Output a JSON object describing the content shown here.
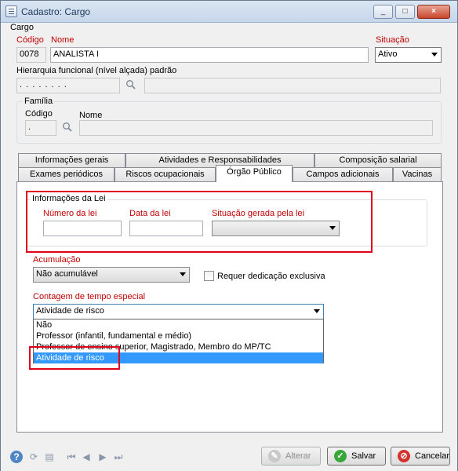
{
  "window": {
    "title": "Cadastro: Cargo",
    "controls": [
      "_",
      "□",
      "×"
    ]
  },
  "cargo_group": {
    "title": "Cargo",
    "codigo_label": "Código",
    "codigo_value": "0078",
    "nome_label": "Nome",
    "nome_value": "ANALISTA I",
    "situacao_label": "Situação",
    "situacao_value": "Ativo",
    "hierarquia_label": "Hierarquia funcional (nível alçada) padrão",
    "hierarquia_value": ". . . . . . . ."
  },
  "familia_group": {
    "title": "Família",
    "codigo_label": "Código",
    "codigo_value": ".",
    "nome_label": "Nome",
    "nome_value": ""
  },
  "tabs": {
    "row1": [
      "Informações gerais",
      "Atividades e Responsabilidades",
      "Composição salarial"
    ],
    "row2": [
      "Exames periódicos",
      "Riscos ocupacionais",
      "Órgão Público",
      "Campos adicionais",
      "Vacinas"
    ],
    "active": "Órgão Público"
  },
  "lei_group": {
    "title": "Informações da Lei",
    "numero_label": "Número da lei",
    "data_label": "Data da lei",
    "situacao_label": "Situação gerada pela lei",
    "numero_value": "",
    "data_value": "",
    "situacao_value": ""
  },
  "acumulacao": {
    "label": "Acumulação",
    "value": "Não acumulável",
    "checkbox_label": "Requer dedicação exclusiva"
  },
  "contagem": {
    "label": "Contagem de tempo especial",
    "value": "Atividade de risco",
    "options": [
      "Não",
      "Professor (infantil, fundamental e médio)",
      "Professor de ensino superior, Magistrado, Membro do MP/TC",
      "Atividade de risco"
    ]
  },
  "footer": {
    "alterar_label": "Alterar",
    "salvar_label": "Salvar",
    "cancelar_label": "Cancelar"
  },
  "colors": {
    "required_red": "#c00000",
    "highlight_box": "#e3001b",
    "selection": "#3399ff"
  },
  "icons": [
    "app-icon",
    "search-icon",
    "help-icon",
    "refresh-icon",
    "document-icon",
    "first-record-icon",
    "previous-record-icon",
    "next-record-icon",
    "last-record-icon",
    "edit-icon",
    "check-icon",
    "cancel-icon"
  ]
}
